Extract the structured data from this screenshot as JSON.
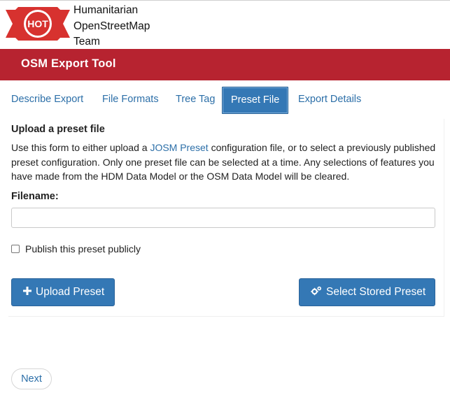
{
  "header": {
    "logo_text": "HOT",
    "org_name_lines": [
      "Humanitarian",
      "OpenStreetMap",
      "Team"
    ],
    "app_title": "OSM Export Tool",
    "brand_color": "#b72330"
  },
  "tabs": [
    {
      "label": "Describe Export",
      "active": false
    },
    {
      "label": "File Formats",
      "active": false
    },
    {
      "label": "Tree Tag",
      "active": false
    },
    {
      "label": "Preset File",
      "active": true
    },
    {
      "label": "Export Details",
      "active": false
    }
  ],
  "preset": {
    "section_title": "Upload a preset file",
    "desc_prefix": "Use this form to either upload a ",
    "desc_link": "JOSM Preset",
    "desc_suffix": " configuration file, or to select a previously published preset configuration. Only one preset file can be selected at a time. Any selections of features you have made from the HDM Data Model or the OSM Data Model will be cleared.",
    "filename_label": "Filename:",
    "filename_value": "",
    "publish_label": "Publish this preset publicly",
    "publish_checked": false,
    "upload_label": "Upload Preset",
    "upload_icon": "plus-icon",
    "stored_label": "Select Stored Preset",
    "stored_icon": "gears-icon",
    "accent_color": "#3478b5"
  },
  "footer": {
    "next_label": "Next"
  }
}
